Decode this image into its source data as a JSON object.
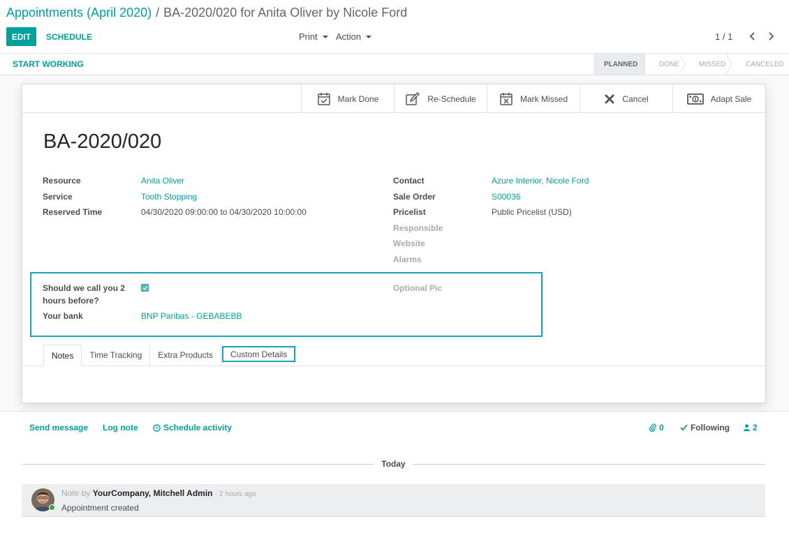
{
  "breadcrumb": {
    "parent": "Appointments (April 2020)",
    "separator": "/",
    "current": "BA-2020/020 for Anita Oliver by Nicole Ford"
  },
  "toolbar": {
    "edit_label": "EDIT",
    "schedule_label": "SCHEDULE",
    "print_label": "Print",
    "action_label": "Action",
    "pager_value": "1 / 1"
  },
  "statusbar": {
    "start_working_label": "START WORKING",
    "stages": [
      "PLANNED",
      "DONE",
      "MISSED",
      "CANCELED"
    ],
    "active_stage": "PLANNED"
  },
  "button_box": {
    "mark_done": "Mark Done",
    "reschedule": "Re-Schedule",
    "mark_missed": "Mark Missed",
    "cancel": "Cancel",
    "adapt_sale": "Adapt Sale"
  },
  "record": {
    "title": "BA-2020/020"
  },
  "fields": {
    "resource_label": "Resource",
    "resource_value": "Anita Oliver",
    "service_label": "Service",
    "service_value": "Tooth Stopping",
    "reserved_time_label": "Reserved Time",
    "reserved_time_value": "04/30/2020 09:00:00 to 04/30/2020 10:00:00",
    "contact_label": "Contact",
    "contact_value": "Azure Interior, Nicole Ford",
    "sale_order_label": "Sale Order",
    "sale_order_value": "S00036",
    "pricelist_label": "Pricelist",
    "pricelist_value": "Public Pricelist (USD)",
    "responsible_label": "Responsible",
    "website_label": "Website",
    "alarms_label": "Alarms",
    "call_before_label": "Should we call you 2 hours before?",
    "call_before_checked": true,
    "bank_label": "Your bank",
    "bank_value": "BNP Paribas - GEBABEBB",
    "optional_pic_label": "Optional Pic"
  },
  "tabs": [
    "Notes",
    "Time Tracking",
    "Extra Products",
    "Custom Details"
  ],
  "chatter": {
    "send_message": "Send message",
    "log_note": "Log note",
    "schedule_activity": "Schedule activity",
    "attachments_count": "0",
    "following_label": "Following",
    "followers_count": "2",
    "date_separator": "Today",
    "message": {
      "prefix": "Note by",
      "author": "YourCompany, Mitchell Admin",
      "date": "- 2 hours ago",
      "body": "Appointment created"
    }
  },
  "colors": {
    "brand": "#00a09d",
    "highlight": "#17a2b8",
    "presence": "#28a745"
  }
}
